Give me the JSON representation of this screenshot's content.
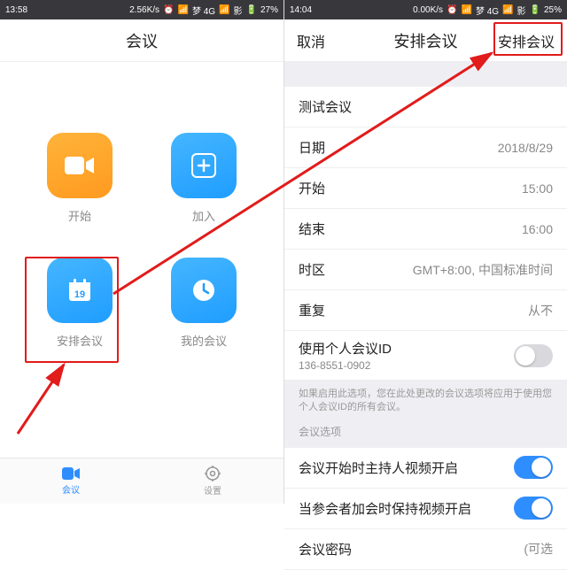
{
  "left": {
    "status": {
      "time": "13:58",
      "net": "2.56K/s",
      "carrier1": "梦 4G",
      "carrier2": "影",
      "battery": "27%"
    },
    "header_title": "会议",
    "tiles": {
      "start": "开始",
      "join": "加入",
      "schedule": "安排会议",
      "mine": "我的会议"
    },
    "tabs": {
      "meeting": "会议",
      "settings": "设置"
    }
  },
  "right": {
    "status": {
      "time": "14:04",
      "net": "0.00K/s",
      "carrier1": "梦 4G",
      "carrier2": "影",
      "battery": "25%"
    },
    "header": {
      "cancel": "取消",
      "title": "安排会议",
      "confirm": "安排会议"
    },
    "rows": {
      "topic": "测试会议",
      "date_label": "日期",
      "date_value": "2018/8/29",
      "start_label": "开始",
      "start_value": "15:00",
      "end_label": "结束",
      "end_value": "16:00",
      "tz_label": "时区",
      "tz_value": "GMT+8:00, 中国标准时间",
      "repeat_label": "重复",
      "repeat_value": "从不",
      "pmi_label": "使用个人会议ID",
      "pmi_sub": "136-8551-0902",
      "note": "如果启用此选项，您在此处更改的会议选项将应用于使用您个人会议ID的所有会议。",
      "options_header": "会议选项",
      "host_video": "会议开始时主持人视频开启",
      "participant_video": "当参会者加会时保持视频开启",
      "password_label": "会议密码",
      "password_value": "(可选"
    }
  }
}
